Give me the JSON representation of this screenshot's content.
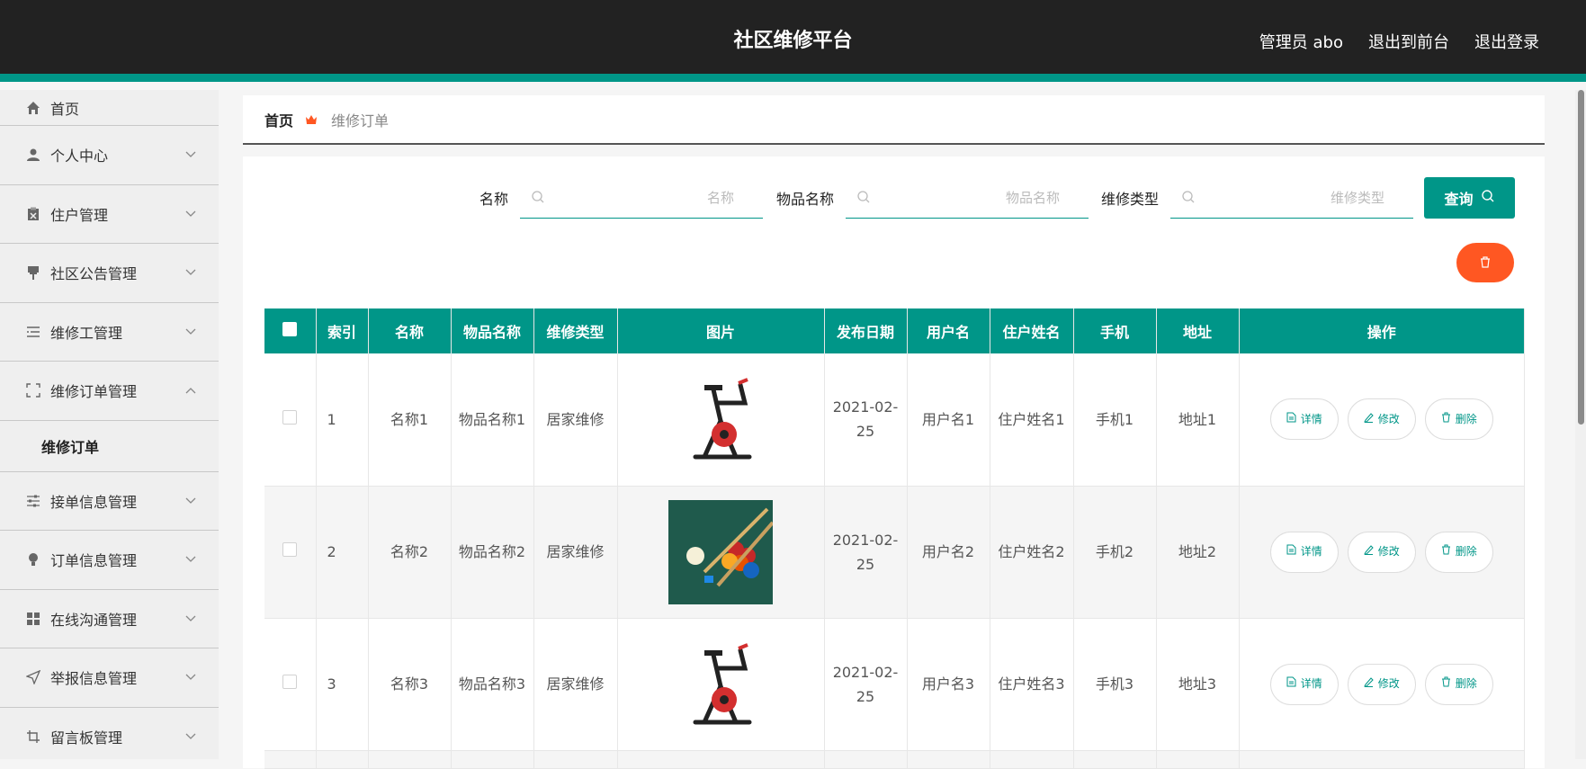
{
  "header": {
    "title": "社区维修平台",
    "user": "管理员 abo",
    "to_front": "退出到前台",
    "logout": "退出登录"
  },
  "sidebar": {
    "items": [
      {
        "label": "首页",
        "icon": "home-icon"
      },
      {
        "label": "个人中心",
        "icon": "user-icon"
      },
      {
        "label": "住户管理",
        "icon": "clipboard-icon"
      },
      {
        "label": "社区公告管理",
        "icon": "pin-icon"
      },
      {
        "label": "维修工管理",
        "icon": "list-icon"
      },
      {
        "label": "维修订单管理",
        "icon": "frame-icon"
      },
      {
        "label": "接单信息管理",
        "icon": "sliders-icon"
      },
      {
        "label": "订单信息管理",
        "icon": "bulb-icon"
      },
      {
        "label": "在线沟通管理",
        "icon": "grid-icon"
      },
      {
        "label": "举报信息管理",
        "icon": "send-icon"
      },
      {
        "label": "留言板管理",
        "icon": "crop-icon"
      }
    ],
    "sub_item": "维修订单"
  },
  "breadcrumb": {
    "home": "首页",
    "current": "维修订单"
  },
  "search": {
    "name_label": "名称",
    "name_placeholder": "名称",
    "item_label": "物品名称",
    "item_placeholder": "物品名称",
    "type_label": "维修类型",
    "type_placeholder": "维修类型",
    "query_label": "查询"
  },
  "table": {
    "headers": [
      "索引",
      "名称",
      "物品名称",
      "维修类型",
      "图片",
      "发布日期",
      "用户名",
      "住户姓名",
      "手机",
      "地址",
      "操作"
    ],
    "rows": [
      {
        "index": "1",
        "name": "名称1",
        "item": "物品名称1",
        "type": "居家维修",
        "image": "exercise-bike",
        "date": "2021-02-25",
        "username": "用户名1",
        "resident": "住户姓名1",
        "phone": "手机1",
        "address": "地址1"
      },
      {
        "index": "2",
        "name": "名称2",
        "item": "物品名称2",
        "type": "居家维修",
        "image": "billiards",
        "date": "2021-02-25",
        "username": "用户名2",
        "resident": "住户姓名2",
        "phone": "手机2",
        "address": "地址2"
      },
      {
        "index": "3",
        "name": "名称3",
        "item": "物品名称3",
        "type": "居家维修",
        "image": "exercise-bike",
        "date": "2021-02-25",
        "username": "用户名3",
        "resident": "住户姓名3",
        "phone": "手机3",
        "address": "地址3"
      }
    ],
    "actions": {
      "detail": "详情",
      "edit": "修改",
      "delete": "删除"
    }
  },
  "colors": {
    "accent": "#009688",
    "danger": "#ff5722",
    "header_bg": "#222222"
  }
}
